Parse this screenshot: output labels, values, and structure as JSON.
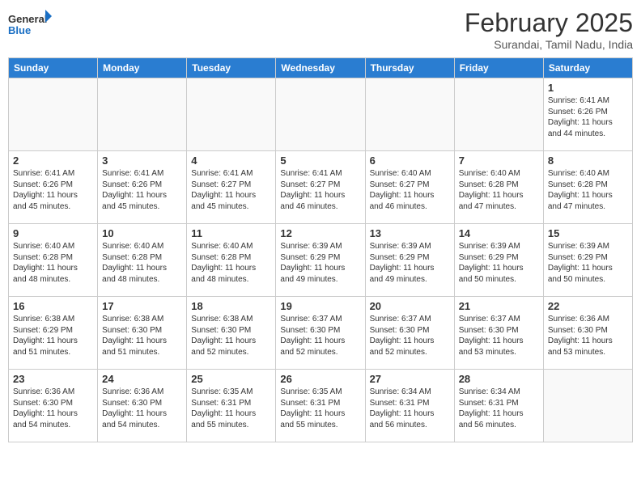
{
  "header": {
    "logo": {
      "text_general": "General",
      "text_blue": "Blue"
    },
    "title": "February 2025",
    "subtitle": "Surandai, Tamil Nadu, India"
  },
  "calendar": {
    "days_of_week": [
      "Sunday",
      "Monday",
      "Tuesday",
      "Wednesday",
      "Thursday",
      "Friday",
      "Saturday"
    ],
    "weeks": [
      [
        {
          "day": "",
          "info": ""
        },
        {
          "day": "",
          "info": ""
        },
        {
          "day": "",
          "info": ""
        },
        {
          "day": "",
          "info": ""
        },
        {
          "day": "",
          "info": ""
        },
        {
          "day": "",
          "info": ""
        },
        {
          "day": "1",
          "info": "Sunrise: 6:41 AM\nSunset: 6:26 PM\nDaylight: 11 hours\nand 44 minutes."
        }
      ],
      [
        {
          "day": "2",
          "info": "Sunrise: 6:41 AM\nSunset: 6:26 PM\nDaylight: 11 hours\nand 45 minutes."
        },
        {
          "day": "3",
          "info": "Sunrise: 6:41 AM\nSunset: 6:26 PM\nDaylight: 11 hours\nand 45 minutes."
        },
        {
          "day": "4",
          "info": "Sunrise: 6:41 AM\nSunset: 6:27 PM\nDaylight: 11 hours\nand 45 minutes."
        },
        {
          "day": "5",
          "info": "Sunrise: 6:41 AM\nSunset: 6:27 PM\nDaylight: 11 hours\nand 46 minutes."
        },
        {
          "day": "6",
          "info": "Sunrise: 6:40 AM\nSunset: 6:27 PM\nDaylight: 11 hours\nand 46 minutes."
        },
        {
          "day": "7",
          "info": "Sunrise: 6:40 AM\nSunset: 6:28 PM\nDaylight: 11 hours\nand 47 minutes."
        },
        {
          "day": "8",
          "info": "Sunrise: 6:40 AM\nSunset: 6:28 PM\nDaylight: 11 hours\nand 47 minutes."
        }
      ],
      [
        {
          "day": "9",
          "info": "Sunrise: 6:40 AM\nSunset: 6:28 PM\nDaylight: 11 hours\nand 48 minutes."
        },
        {
          "day": "10",
          "info": "Sunrise: 6:40 AM\nSunset: 6:28 PM\nDaylight: 11 hours\nand 48 minutes."
        },
        {
          "day": "11",
          "info": "Sunrise: 6:40 AM\nSunset: 6:28 PM\nDaylight: 11 hours\nand 48 minutes."
        },
        {
          "day": "12",
          "info": "Sunrise: 6:39 AM\nSunset: 6:29 PM\nDaylight: 11 hours\nand 49 minutes."
        },
        {
          "day": "13",
          "info": "Sunrise: 6:39 AM\nSunset: 6:29 PM\nDaylight: 11 hours\nand 49 minutes."
        },
        {
          "day": "14",
          "info": "Sunrise: 6:39 AM\nSunset: 6:29 PM\nDaylight: 11 hours\nand 50 minutes."
        },
        {
          "day": "15",
          "info": "Sunrise: 6:39 AM\nSunset: 6:29 PM\nDaylight: 11 hours\nand 50 minutes."
        }
      ],
      [
        {
          "day": "16",
          "info": "Sunrise: 6:38 AM\nSunset: 6:29 PM\nDaylight: 11 hours\nand 51 minutes."
        },
        {
          "day": "17",
          "info": "Sunrise: 6:38 AM\nSunset: 6:30 PM\nDaylight: 11 hours\nand 51 minutes."
        },
        {
          "day": "18",
          "info": "Sunrise: 6:38 AM\nSunset: 6:30 PM\nDaylight: 11 hours\nand 52 minutes."
        },
        {
          "day": "19",
          "info": "Sunrise: 6:37 AM\nSunset: 6:30 PM\nDaylight: 11 hours\nand 52 minutes."
        },
        {
          "day": "20",
          "info": "Sunrise: 6:37 AM\nSunset: 6:30 PM\nDaylight: 11 hours\nand 52 minutes."
        },
        {
          "day": "21",
          "info": "Sunrise: 6:37 AM\nSunset: 6:30 PM\nDaylight: 11 hours\nand 53 minutes."
        },
        {
          "day": "22",
          "info": "Sunrise: 6:36 AM\nSunset: 6:30 PM\nDaylight: 11 hours\nand 53 minutes."
        }
      ],
      [
        {
          "day": "23",
          "info": "Sunrise: 6:36 AM\nSunset: 6:30 PM\nDaylight: 11 hours\nand 54 minutes."
        },
        {
          "day": "24",
          "info": "Sunrise: 6:36 AM\nSunset: 6:30 PM\nDaylight: 11 hours\nand 54 minutes."
        },
        {
          "day": "25",
          "info": "Sunrise: 6:35 AM\nSunset: 6:31 PM\nDaylight: 11 hours\nand 55 minutes."
        },
        {
          "day": "26",
          "info": "Sunrise: 6:35 AM\nSunset: 6:31 PM\nDaylight: 11 hours\nand 55 minutes."
        },
        {
          "day": "27",
          "info": "Sunrise: 6:34 AM\nSunset: 6:31 PM\nDaylight: 11 hours\nand 56 minutes."
        },
        {
          "day": "28",
          "info": "Sunrise: 6:34 AM\nSunset: 6:31 PM\nDaylight: 11 hours\nand 56 minutes."
        },
        {
          "day": "",
          "info": ""
        }
      ]
    ]
  }
}
